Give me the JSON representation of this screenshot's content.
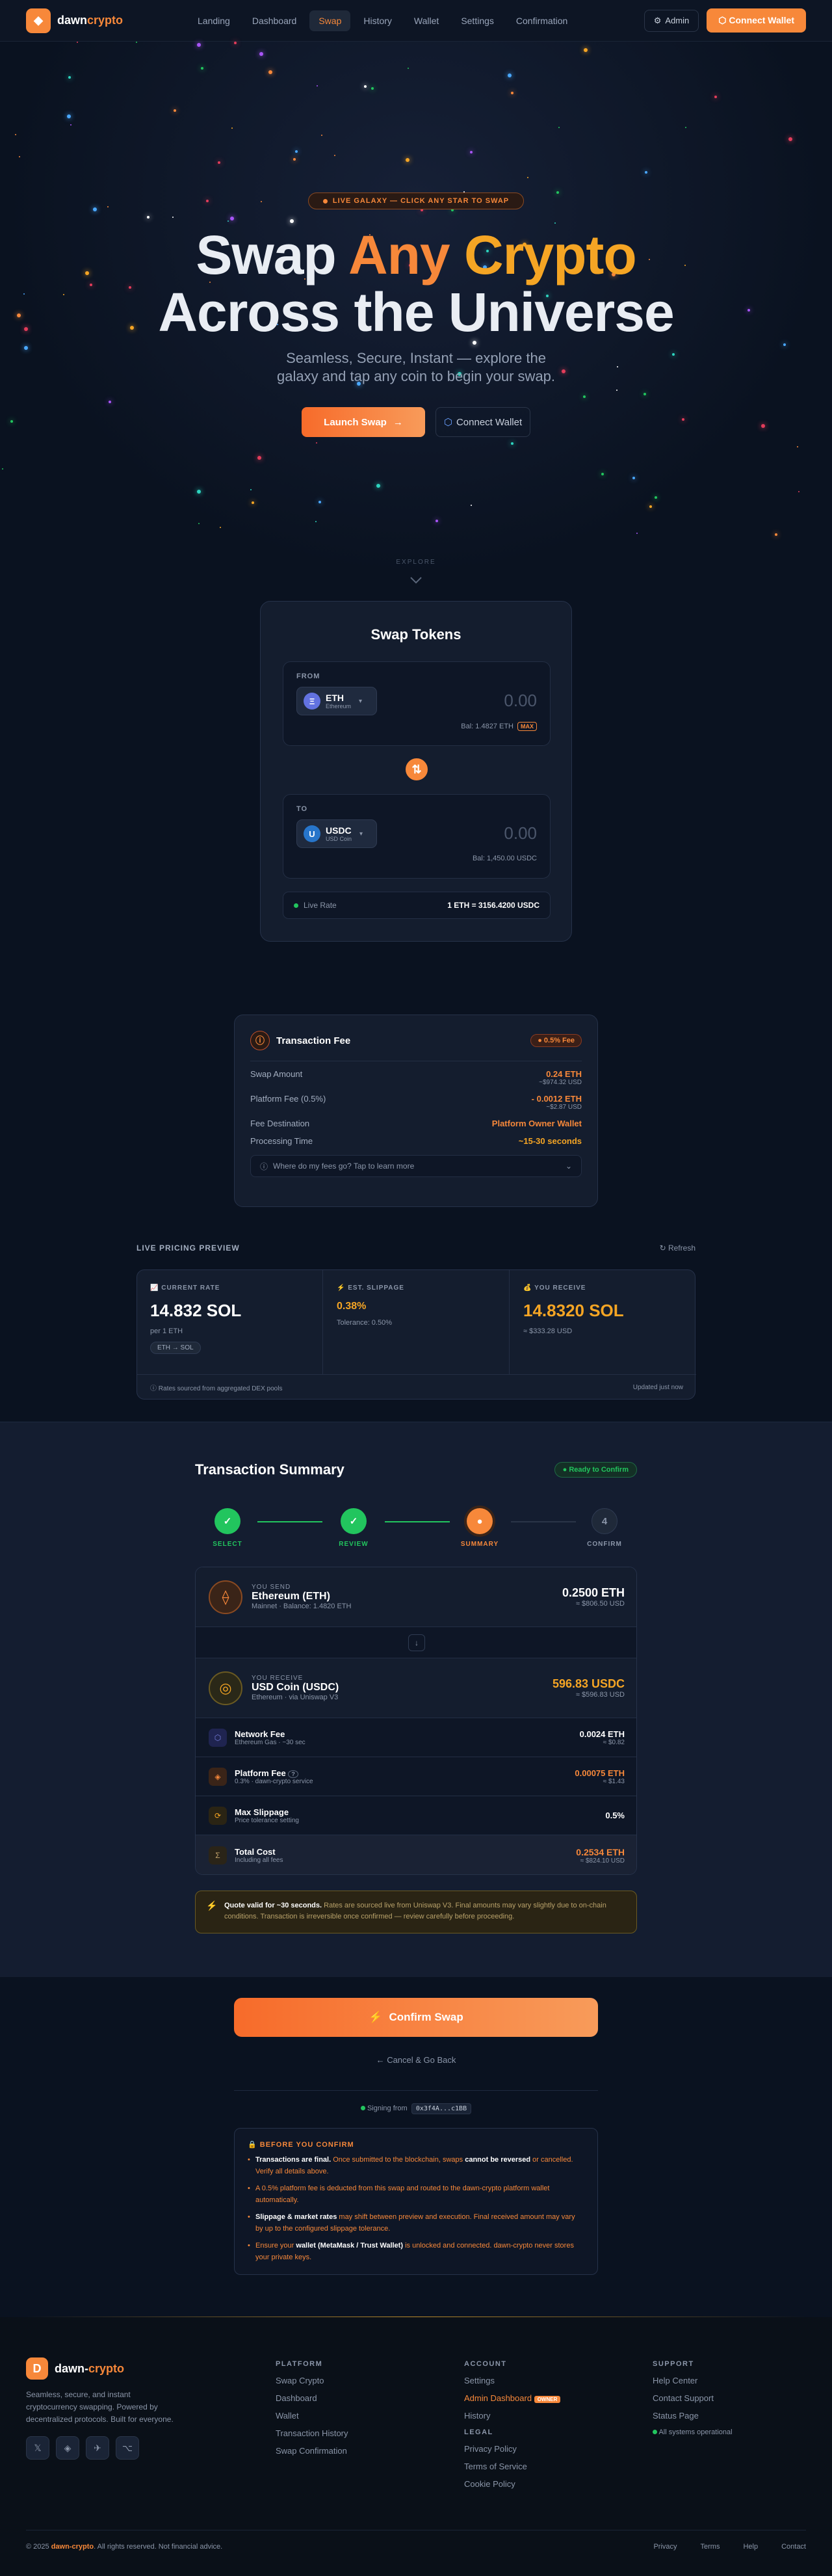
{
  "nav": {
    "logo_a": "dawn",
    "logo_b": "crypto",
    "links": [
      "Landing",
      "Dashboard",
      "Swap",
      "History",
      "Wallet",
      "Settings",
      "Confirmation"
    ],
    "admin": "Admin",
    "connect": "Connect Wallet"
  },
  "hero": {
    "badge": "LIVE GALAXY — CLICK ANY STAR TO SWAP",
    "title_1a": "Swap ",
    "title_1b": "Any",
    "title_1c": " Crypto",
    "title_2": "Across the Universe",
    "sub_1": "Seamless, Secure, Instant — explore the",
    "sub_2": "galaxy and tap any coin to begin your swap.",
    "launch": "Launch Swap",
    "connect": "Connect Wallet",
    "explore": "EXPLORE"
  },
  "swap": {
    "title": "Swap Tokens",
    "from_label": "FROM",
    "from_symbol": "ETH",
    "from_name": "Ethereum",
    "from_amount": "0.00",
    "from_balance": "Bal: 1.4827 ETH",
    "max": "MAX",
    "to_label": "TO",
    "to_symbol": "USDC",
    "to_name": "USD Coin",
    "to_amount": "0.00",
    "to_balance": "Bal: 1,450.00 USDC",
    "rate_label": "Live Rate",
    "rate_value": "1 ETH = 3156.4200 USDC"
  },
  "fee": {
    "title": "Transaction Fee",
    "pill": "0.5% Fee",
    "rows": [
      {
        "label": "Swap Amount",
        "value": "0.24 ETH",
        "sub": "~$974.32 USD"
      },
      {
        "label": "Platform Fee (0.5%)",
        "value": "- 0.0012 ETH",
        "sub": "~$2.87 USD"
      },
      {
        "label": "Fee Destination",
        "value": "Platform Owner Wallet",
        "sub": ""
      },
      {
        "label": "Processing Time",
        "value": "~15-30 seconds",
        "sub": ""
      }
    ],
    "more": "Where do my fees go? Tap to learn more"
  },
  "pricing": {
    "title": "LIVE PRICING PREVIEW",
    "refresh": "Refresh",
    "rate_label": "CURRENT RATE",
    "rate_value": "14.832 SOL",
    "rate_sub": "per 1 ETH",
    "pair": "ETH → SOL",
    "slip_label": "EST. SLIPPAGE",
    "slip_value": "0.38%",
    "slip_sub": "Tolerance: 0.50%",
    "recv_label": "YOU RECEIVE",
    "recv_value": "14.8320 SOL",
    "recv_sub": "≈ $333.28 USD",
    "source": "Rates sourced from aggregated DEX pools",
    "updated": "Updated just now"
  },
  "summary": {
    "title": "Transaction Summary",
    "status": "Ready to Confirm",
    "steps": [
      "SELECT",
      "REVIEW",
      "SUMMARY",
      "CONFIRM"
    ],
    "step4_num": "4",
    "send_label": "YOU SEND",
    "send_name": "Ethereum (ETH)",
    "send_sub": "Mainnet · Balance: 1.4820 ETH",
    "send_value": "0.2500 ETH",
    "send_usd": "≈ $806.50 USD",
    "recv_label": "YOU RECEIVE",
    "recv_name": "USD Coin (USDC)",
    "recv_sub": "Ethereum · via Uniswap V3",
    "recv_value": "596.83 USDC",
    "recv_usd": "≈ $596.83 USD",
    "rows": [
      {
        "name": "Network Fee",
        "sub": "Ethereum Gas · ~30 sec",
        "value": "0.0024 ETH",
        "vsub": "≈ $0.82"
      },
      {
        "name": "Platform Fee",
        "sub": "0.3% · dawn-crypto service",
        "value": "0.00075 ETH",
        "vsub": "≈ $1.43"
      },
      {
        "name": "Max Slippage",
        "sub": "Price tolerance setting",
        "value": "0.5%",
        "vsub": ""
      },
      {
        "name": "Total Cost",
        "sub": "Including all fees",
        "value": "0.2534 ETH",
        "vsub": "≈ $824.10 USD"
      }
    ],
    "quote_b": "Quote valid for ~30 seconds.",
    "quote_t": " Rates are sourced live from Uniswap V3. Final amounts may vary slightly due to on-chain conditions. Transaction is irreversible once confirmed — review carefully before proceeding."
  },
  "confirm": {
    "button": "Confirm Swap",
    "cancel": "← Cancel & Go Back",
    "signing": "Signing from",
    "address": "0x3f4A...c1BB",
    "before_title": "BEFORE YOU CONFIRM",
    "b1a": "Transactions are final.",
    "b1b": " Once submitted to the blockchain, swaps ",
    "b1c": "cannot be reversed",
    "b1d": " or cancelled. Verify all details above.",
    "b2": "A 0.5% platform fee is deducted from this swap and routed to the dawn-crypto platform wallet automatically.",
    "b3a": "Slippage & market rates",
    "b3b": " may shift between preview and execution. Final received amount may vary by up to the configured slippage tolerance.",
    "b4a": "Ensure your ",
    "b4b": "wallet (MetaMask / Trust Wallet)",
    "b4c": " is unlocked and connected. dawn-crypto never stores your private keys."
  },
  "footer": {
    "brand_a": "dawn-",
    "brand_b": "crypto",
    "desc": "Seamless, secure, and instant cryptocurrency swapping. Powered by decentralized protocols. Built for everyone.",
    "platform_title": "PLATFORM",
    "platform": [
      "Swap Crypto",
      "Dashboard",
      "Wallet",
      "Transaction History",
      "Swap Confirmation"
    ],
    "account_title": "ACCOUNT",
    "account": [
      "Settings",
      "Admin Dashboard",
      "History"
    ],
    "admin_badge": "OWNER",
    "legal_title": "LEGAL",
    "legal": [
      "Privacy Policy",
      "Terms of Service",
      "Cookie Policy"
    ],
    "support_title": "SUPPORT",
    "support": [
      "Help Center",
      "Contact Support",
      "Status Page"
    ],
    "status": "All systems operational",
    "copy_a": "© 2025 ",
    "copy_b": "dawn-crypto",
    "copy_c": ". All rights reserved. Not financial advice.",
    "bottom_links": [
      "Privacy",
      "Terms",
      "Help",
      "Contact"
    ]
  }
}
